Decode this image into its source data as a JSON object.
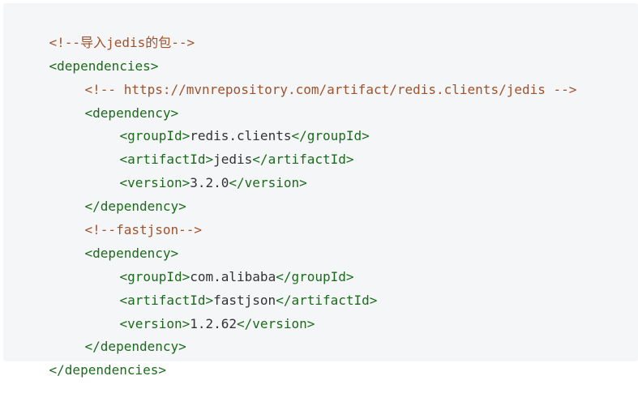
{
  "code": {
    "language": "xml",
    "lines": [
      {
        "comment": "<!--导入jedis的包-->"
      },
      {
        "tag": "<dependencies>"
      },
      {
        "comment": "<!-- https://mvnrepository.com/artifact/redis.clients/jedis -->"
      },
      {
        "tag": "<dependency>"
      },
      {
        "open": "<groupId>",
        "text": "redis.clients",
        "close": "</groupId>"
      },
      {
        "open": "<artifactId>",
        "text": "jedis",
        "close": "</artifactId>"
      },
      {
        "open": "<version>",
        "text": "3.2.0",
        "close": "</version>"
      },
      {
        "tag": "</dependency>"
      },
      {
        "comment": "<!--fastjson-->"
      },
      {
        "tag": "<dependency>"
      },
      {
        "open": "<groupId>",
        "text": "com.alibaba",
        "close": "</groupId>"
      },
      {
        "open": "<artifactId>",
        "text": "fastjson",
        "close": "</artifactId>"
      },
      {
        "open": "<version>",
        "text": "1.2.62",
        "close": "</version>"
      },
      {
        "tag": "</dependency>"
      },
      {
        "tag": "</dependencies>"
      }
    ],
    "colors": {
      "background": "#f5f6f7",
      "comment": "#a0522d",
      "tag": "#1a6b1a",
      "text": "#333333"
    }
  }
}
